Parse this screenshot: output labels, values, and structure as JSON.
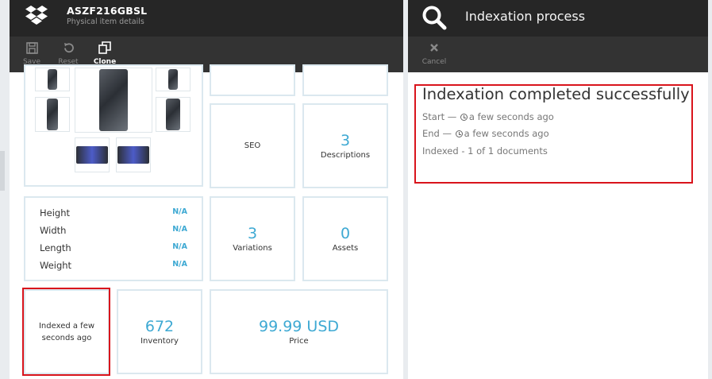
{
  "left_blade": {
    "title": "ASZF216GBSL",
    "subtitle": "Physical item details",
    "toolbar": [
      {
        "label": "Save",
        "icon": "save-icon",
        "active": false
      },
      {
        "label": "Reset",
        "icon": "reset-icon",
        "active": false
      },
      {
        "label": "Clone",
        "icon": "clone-icon",
        "active": true
      }
    ],
    "cards": {
      "seo": {
        "label": "SEO"
      },
      "descriptions": {
        "value": "3",
        "label": "Descriptions"
      },
      "variations": {
        "value": "3",
        "label": "Variations"
      },
      "assets": {
        "value": "0",
        "label": "Assets"
      },
      "indexed": {
        "label": "Indexed a few seconds ago"
      },
      "inventory": {
        "value": "672",
        "label": "Inventory"
      },
      "price": {
        "value": "99.99 USD",
        "label": "Price"
      }
    },
    "dimensions": [
      {
        "label": "Height",
        "value": "N/A"
      },
      {
        "label": "Width",
        "value": "N/A"
      },
      {
        "label": "Length",
        "value": "N/A"
      },
      {
        "label": "Weight",
        "value": "N/A"
      }
    ]
  },
  "right_blade": {
    "title": "Indexation process",
    "toolbar": [
      {
        "label": "Cancel",
        "icon": "close-icon",
        "active": false
      }
    ],
    "result": {
      "heading": "Indexation completed successfully",
      "start_prefix": "Start —",
      "start_value": "a few seconds ago",
      "end_prefix": "End —",
      "end_value": "a few seconds ago",
      "indexed": "Indexed - 1 of 1 documents"
    }
  },
  "colors": {
    "header_bg": "#262626",
    "toolbar_bg": "#333333",
    "accent": "#3ea9d3",
    "highlight": "#d9141c",
    "card_border": "#dbe8ef"
  }
}
